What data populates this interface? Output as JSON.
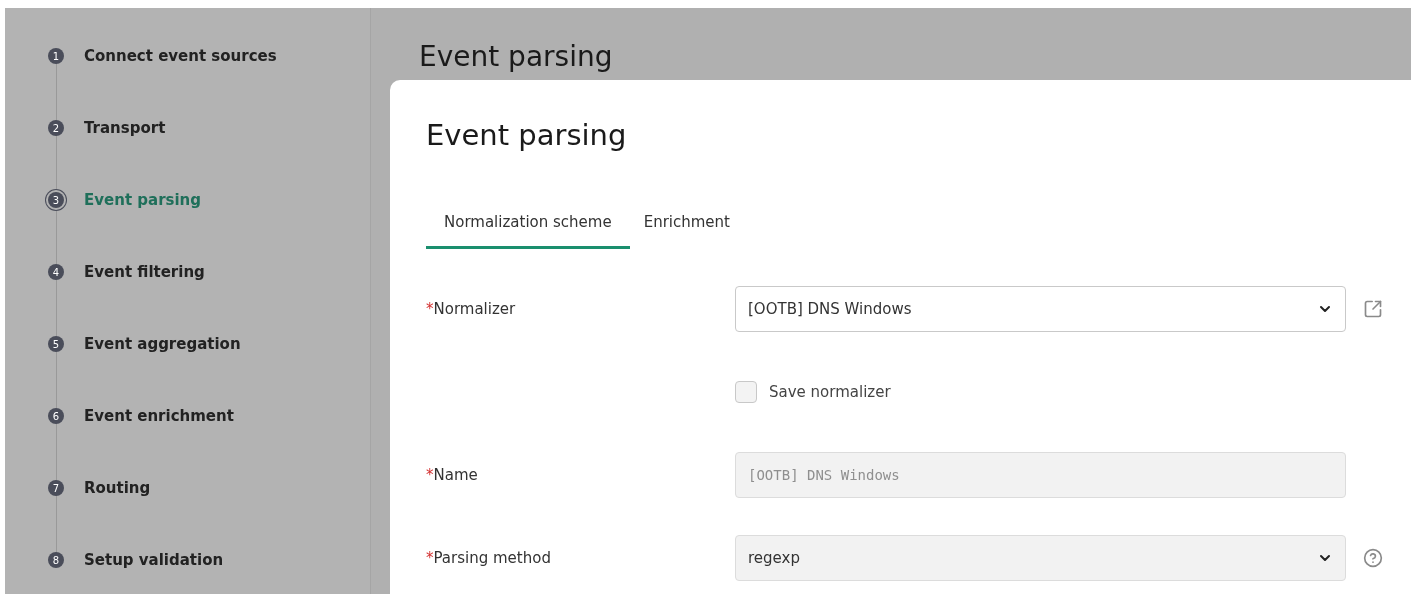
{
  "steps": [
    {
      "number": "1",
      "label": "Connect event sources",
      "selected": false
    },
    {
      "number": "2",
      "label": "Transport",
      "selected": false
    },
    {
      "number": "3",
      "label": "Event parsing",
      "selected": true
    },
    {
      "number": "4",
      "label": "Event filtering",
      "selected": false
    },
    {
      "number": "5",
      "label": "Event aggregation",
      "selected": false
    },
    {
      "number": "6",
      "label": "Event enrichment",
      "selected": false
    },
    {
      "number": "7",
      "label": "Routing",
      "selected": false
    },
    {
      "number": "8",
      "label": "Setup validation",
      "selected": false
    }
  ],
  "page_title": "Event parsing",
  "modal": {
    "title": "Event parsing",
    "tabs": [
      {
        "label": "Normalization scheme",
        "selected": true
      },
      {
        "label": "Enrichment",
        "selected": false
      }
    ],
    "fields": [
      {
        "kind": "select",
        "required_mark": "*",
        "label": "Normalizer",
        "value": "[OOTB] DNS Windows",
        "disabled": false,
        "external_link": true
      },
      {
        "kind": "checkbox",
        "label": "Save normalizer",
        "checked": false
      },
      {
        "kind": "text",
        "required_mark": "*",
        "label": "Name",
        "placeholder": "[OOTB] DNS Windows",
        "disabled": true
      },
      {
        "kind": "select",
        "required_mark": "*",
        "label": "Parsing method",
        "value": "regexp",
        "disabled": true,
        "help": true
      }
    ]
  }
}
